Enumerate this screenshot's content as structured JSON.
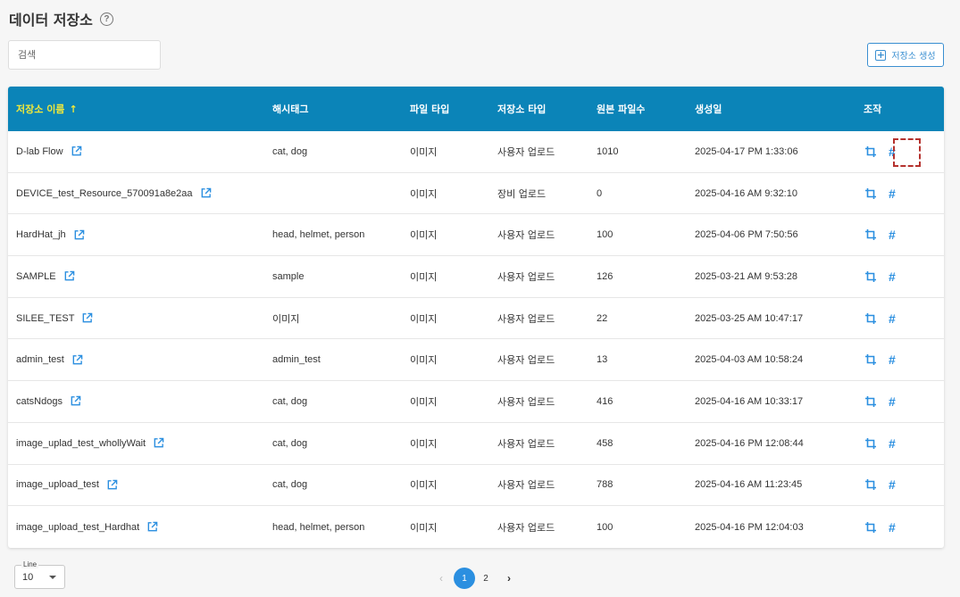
{
  "header": {
    "title": "데이터 저장소",
    "help": "?"
  },
  "search": {
    "placeholder": "검색"
  },
  "create_button": {
    "label": "저장소 생성"
  },
  "table": {
    "columns": [
      "저장소 이름",
      "해시태그",
      "파일 타입",
      "저장소 타입",
      "원본 파일수",
      "생성일",
      "조작"
    ],
    "sort_indicator": "↑",
    "rows": [
      {
        "name": "D-lab Flow",
        "tags": "cat, dog",
        "file_type": "이미지",
        "storage_type": "사용자 업로드",
        "count": "1010",
        "created": "2025-04-17 PM 1:33:06"
      },
      {
        "name": "DEVICE_test_Resource_570091a8e2aa",
        "tags": "",
        "file_type": "이미지",
        "storage_type": "장비 업로드",
        "count": "0",
        "created": "2025-04-16 AM 9:32:10"
      },
      {
        "name": "HardHat_jh",
        "tags": "head, helmet, person",
        "file_type": "이미지",
        "storage_type": "사용자 업로드",
        "count": "100",
        "created": "2025-04-06 PM 7:50:56"
      },
      {
        "name": "SAMPLE",
        "tags": "sample",
        "file_type": "이미지",
        "storage_type": "사용자 업로드",
        "count": "126",
        "created": "2025-03-21 AM 9:53:28"
      },
      {
        "name": "SILEE_TEST",
        "tags": "이미지",
        "file_type": "이미지",
        "storage_type": "사용자 업로드",
        "count": "22",
        "created": "2025-03-25 AM 10:47:17"
      },
      {
        "name": "admin_test",
        "tags": "admin_test",
        "file_type": "이미지",
        "storage_type": "사용자 업로드",
        "count": "13",
        "created": "2025-04-03 AM 10:58:24"
      },
      {
        "name": "catsNdogs",
        "tags": "cat, dog",
        "file_type": "이미지",
        "storage_type": "사용자 업로드",
        "count": "416",
        "created": "2025-04-16 AM 10:33:17"
      },
      {
        "name": "image_uplad_test_whollyWait",
        "tags": "cat, dog",
        "file_type": "이미지",
        "storage_type": "사용자 업로드",
        "count": "458",
        "created": "2025-04-16 PM 12:08:44"
      },
      {
        "name": "image_upload_test",
        "tags": "cat, dog",
        "file_type": "이미지",
        "storage_type": "사용자 업로드",
        "count": "788",
        "created": "2025-04-16 AM 11:23:45"
      },
      {
        "name": "image_upload_test_Hardhat",
        "tags": "head, helmet, person",
        "file_type": "이미지",
        "storage_type": "사용자 업로드",
        "count": "100",
        "created": "2025-04-16 PM 12:04:03"
      }
    ]
  },
  "line_select": {
    "label": "Line",
    "value": "10"
  },
  "pagination": {
    "prev": "‹",
    "pages": [
      "1",
      "2"
    ],
    "active": "1",
    "next": "›"
  },
  "colors": {
    "header_bg": "#0b84b8",
    "sorted_header": "#f2e93a",
    "accent": "#2b8fe0",
    "highlight_box": "#b5322e"
  }
}
